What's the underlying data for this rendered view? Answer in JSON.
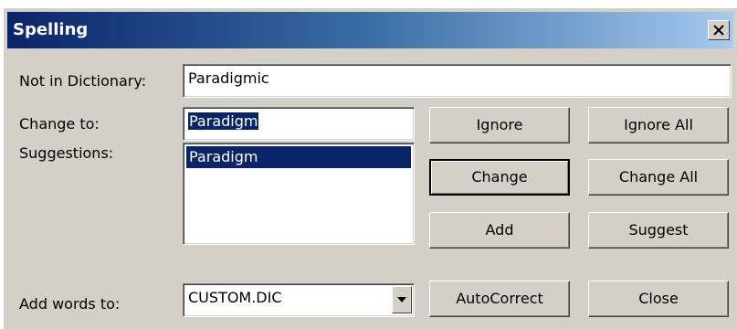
{
  "window": {
    "title": "Spelling",
    "close_symbol": "✕"
  },
  "labels": {
    "not_in_dictionary": "Not in Dictionary:",
    "change_to": "Change to:",
    "suggestions": "Suggestions:",
    "add_words_to": "Add words to:"
  },
  "fields": {
    "not_in_dictionary_value": "Paradigmic",
    "change_to_value": "Paradigm",
    "suggestions": [
      "Paradigm"
    ],
    "selected_suggestion": "Paradigm",
    "add_words_to_value": "CUSTOM.DIC"
  },
  "buttons": {
    "ignore": "Ignore",
    "ignore_all": "Ignore All",
    "change": "Change",
    "change_all": "Change All",
    "add": "Add",
    "suggest": "Suggest",
    "autocorrect": "AutoCorrect",
    "close": "Close"
  },
  "colors": {
    "dialog_face": "#d4d0c8",
    "selection": "#0a246a",
    "title_gradient_start": "#0a246a",
    "title_gradient_end": "#a6caf0"
  },
  "icons": {
    "close": "close-icon",
    "combo_dropdown": "chevron-down-icon"
  }
}
